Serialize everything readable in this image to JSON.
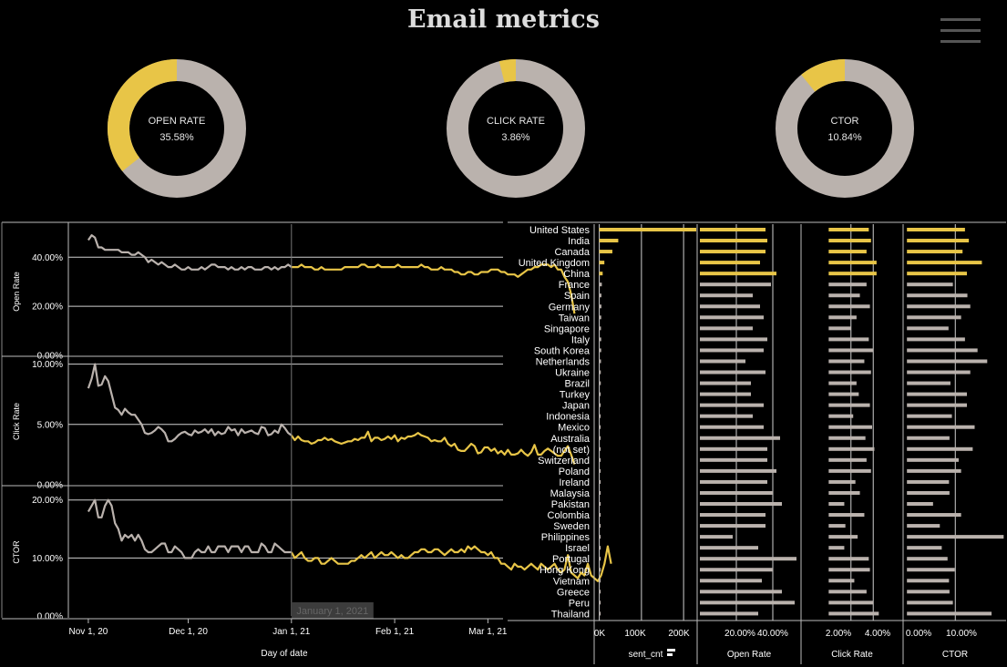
{
  "header": {
    "title": "Email metrics"
  },
  "colors": {
    "highlight": "#e8c547",
    "base": "#bab2ad",
    "grid": "#cfcfcf",
    "axis": "#ffffff"
  },
  "donuts": [
    {
      "label": "OPEN RATE",
      "value_text": "35.58%",
      "value": 35.58
    },
    {
      "label": "CLICK RATE",
      "value_text": "3.86%",
      "value": 3.86
    },
    {
      "label": "CTOR",
      "value_text": "10.84%",
      "value": 10.84
    }
  ],
  "chart_data": [
    {
      "type": "line",
      "title": "",
      "xlabel": "Day of date",
      "x_ticks": [
        "Nov 1, 20",
        "Dec 1, 20",
        "Jan 1, 21",
        "Feb 1, 21",
        "Mar 1, 21"
      ],
      "x_range": [
        "2020-10-26",
        "2021-03-05"
      ],
      "reference_line": {
        "date": "2021-01-01",
        "label": "January 1, 2021"
      },
      "series": [
        {
          "ylabel": "Open Rate",
          "y_ticks": [
            "0.00%",
            "20.00%",
            "40.00%"
          ],
          "ylim": [
            0,
            52
          ],
          "start_date": "2020-11-01",
          "values": [
            47,
            49,
            48,
            44,
            44,
            43,
            43,
            43,
            43,
            43,
            42,
            42,
            42,
            41,
            41,
            42,
            41,
            40,
            38,
            39,
            38,
            37,
            38,
            37,
            36,
            36,
            37,
            36,
            35,
            35,
            36,
            35,
            35,
            35,
            36,
            35,
            36,
            37,
            37,
            36,
            36,
            36,
            35,
            36,
            35,
            35,
            36,
            35,
            36,
            36,
            35,
            35,
            35,
            36,
            36,
            35,
            36,
            35,
            36,
            36,
            37,
            36,
            36,
            36,
            37,
            36,
            36,
            36,
            35,
            35,
            36,
            35,
            35,
            35,
            35,
            35,
            35,
            36,
            36,
            36,
            36,
            36,
            37,
            37,
            36,
            36,
            36,
            37,
            36,
            36,
            36,
            36,
            36,
            37,
            36,
            36,
            36,
            36,
            36,
            36,
            37,
            36,
            36,
            35,
            35,
            35,
            36,
            35,
            35,
            35,
            34,
            34,
            33,
            33,
            34,
            34,
            33,
            33,
            34,
            34,
            34,
            35,
            35,
            35,
            34,
            34,
            33,
            33,
            33,
            32,
            33,
            34,
            35,
            35,
            36,
            36,
            37,
            37,
            37,
            36,
            37,
            35,
            35,
            32,
            30,
            25,
            17
          ]
        },
        {
          "ylabel": "Click Rate",
          "y_ticks": [
            "0.00%",
            "5.00%",
            "10.00%"
          ],
          "ylim": [
            0,
            10.5
          ],
          "start_date": "2020-11-01",
          "values": [
            8.0,
            8.8,
            10.0,
            8.2,
            8.3,
            9.0,
            8.6,
            7.5,
            6.4,
            6.2,
            5.8,
            6.3,
            6.0,
            5.8,
            5.8,
            5.4,
            5.0,
            4.3,
            4.2,
            4.3,
            4.5,
            4.8,
            4.6,
            4.3,
            3.6,
            3.6,
            3.8,
            4.1,
            4.3,
            4.4,
            4.2,
            4.1,
            4.5,
            4.3,
            4.4,
            4.6,
            4.3,
            4.6,
            4.1,
            4.4,
            4.2,
            4.3,
            4.8,
            4.5,
            4.6,
            4.1,
            4.6,
            4.3,
            4.4,
            4.5,
            4.3,
            4.2,
            4.8,
            4.7,
            4.1,
            4.2,
            4.5,
            4.3,
            5.0,
            4.7,
            4.3,
            4.1,
            3.7,
            4.0,
            3.7,
            3.6,
            3.6,
            3.4,
            3.5,
            3.7,
            3.7,
            3.9,
            3.7,
            3.8,
            3.6,
            3.5,
            3.4,
            3.5,
            3.6,
            3.6,
            3.8,
            3.7,
            3.9,
            3.9,
            4.4,
            3.6,
            3.9,
            3.9,
            3.7,
            3.8,
            4.0,
            3.8,
            4.1,
            3.6,
            3.9,
            3.8,
            4.0,
            4.0,
            4.1,
            4.3,
            4.1,
            4.0,
            3.9,
            3.6,
            3.7,
            3.6,
            3.6,
            3.9,
            3.4,
            3.2,
            3.4,
            2.9,
            2.8,
            2.8,
            3.1,
            3.4,
            3.2,
            2.6,
            2.7,
            3.1,
            3.1,
            2.8,
            3.0,
            2.6,
            2.8,
            2.5,
            2.9,
            2.5,
            2.5,
            2.6,
            2.9,
            2.6,
            2.4,
            2.7,
            3.3,
            2.5,
            2.5,
            2.8,
            3.0,
            2.8,
            2.6,
            2.4,
            2.4,
            2.8,
            3.2,
            2.5,
            1.7
          ]
        },
        {
          "ylabel": "CTOR",
          "y_ticks": [
            "0.00%",
            "10.00%",
            "20.00%"
          ],
          "ylim": [
            0,
            22
          ],
          "start_date": "2020-11-01",
          "values": [
            18,
            19,
            20,
            17,
            17,
            19,
            20,
            19,
            16,
            15,
            13,
            14,
            13.5,
            14,
            13,
            14,
            13,
            11.5,
            11,
            11,
            11.5,
            12,
            12.5,
            12.5,
            11,
            11,
            12,
            11.5,
            11,
            10,
            10,
            10,
            11,
            11.5,
            11,
            11,
            12,
            11,
            11,
            12,
            12,
            12,
            11,
            12,
            12,
            12,
            11,
            12,
            12,
            11,
            11,
            11,
            12.5,
            12,
            11,
            11,
            12.5,
            12,
            11.5,
            11,
            11,
            11,
            10,
            10.5,
            11,
            10,
            9.5,
            9.5,
            10,
            10,
            9,
            9,
            9.5,
            10,
            9.5,
            9,
            9,
            9,
            9,
            9.5,
            9.5,
            10,
            10.5,
            10,
            10.5,
            11,
            10,
            10.5,
            11,
            10.5,
            10.5,
            11,
            10.5,
            10,
            10.5,
            10,
            10,
            10.5,
            11,
            11,
            11.5,
            11.5,
            11,
            11,
            11.5,
            11.5,
            11,
            10.5,
            11,
            11.5,
            11,
            11,
            11.5,
            11,
            12,
            11.5,
            12,
            11.5,
            11,
            11,
            10.5,
            11,
            10,
            10,
            9,
            9,
            8.5,
            8,
            9,
            8.5,
            8.5,
            8,
            8.5,
            9,
            8.5,
            8,
            9,
            8.5,
            8,
            8.5,
            9,
            8,
            7.5,
            8,
            10.5,
            7.5,
            7,
            6.5,
            7.5,
            7,
            9,
            7,
            6.5,
            6,
            7,
            9,
            12,
            9
          ]
        }
      ]
    },
    {
      "type": "bar",
      "orientation": "horizontal",
      "categories": [
        "United States",
        "India",
        "Canada",
        "United Kingdom",
        "China",
        "France",
        "Spain",
        "Germany",
        "Taiwan",
        "Singapore",
        "Italy",
        "South Korea",
        "Netherlands",
        "Ukraine",
        "Brazil",
        "Turkey",
        "Japan",
        "Indonesia",
        "Mexico",
        "Australia",
        "(not set)",
        "Switzerland",
        "Poland",
        "Ireland",
        "Malaysia",
        "Pakistan",
        "Colombia",
        "Sweden",
        "Philippines",
        "Israel",
        "Portugal",
        "Hong Kong",
        "Vietnam",
        "Greece",
        "Peru",
        "Thailand"
      ],
      "highlighted": [
        "United States",
        "India",
        "Canada",
        "United Kingdom",
        "China"
      ],
      "series": [
        {
          "name": "sent_cnt",
          "x_ticks": [
            "0K",
            "100K",
            "200K"
          ],
          "xlim": [
            -10000,
            230000
          ],
          "values": [
            232000,
            45000,
            31000,
            12000,
            8000,
            6000,
            5000,
            5000,
            4500,
            4000,
            4500,
            4500,
            4000,
            3500,
            3500,
            3000,
            3000,
            3000,
            3000,
            3000,
            3000,
            2500,
            2500,
            2500,
            2500,
            2500,
            2500,
            2500,
            2000,
            2000,
            2000,
            2000,
            2000,
            2000,
            2000,
            2000
          ]
        },
        {
          "name": "Open Rate",
          "x_ticks": [
            "20.00%",
            "40.00%"
          ],
          "xlim": [
            -1,
            55
          ],
          "values": [
            36,
            37,
            36,
            33,
            42,
            39,
            29,
            33,
            35,
            29,
            37,
            35,
            25,
            36,
            28,
            28,
            35,
            29,
            35,
            44,
            37,
            37,
            42,
            37,
            40,
            45,
            36,
            36,
            18,
            32,
            53,
            40,
            34,
            45,
            52,
            32
          ]
        },
        {
          "name": "Click Rate",
          "x_ticks": [
            "2.00%",
            "4.00%"
          ],
          "xlim": [
            -2.4,
            6.6
          ],
          "values": [
            3.6,
            3.8,
            3.4,
            4.3,
            4.3,
            3.4,
            2.8,
            3.7,
            2.5,
            2.0,
            3.6,
            4.0,
            3.2,
            3.8,
            2.5,
            2.7,
            3.7,
            2.2,
            3.9,
            3.3,
            4.1,
            3.4,
            3.8,
            2.4,
            2.8,
            1.4,
            3.2,
            1.5,
            2.6,
            1.4,
            3.6,
            3.7,
            2.3,
            3.4,
            4.0,
            4.5
          ]
        },
        {
          "name": "CTOR",
          "x_ticks": [
            "0.00%",
            "10.00%"
          ],
          "xlim": [
            -0.6,
            20.5
          ],
          "values": [
            12,
            12.8,
            11.5,
            15.5,
            12.4,
            9.5,
            12.5,
            13.1,
            11.2,
            8.6,
            12,
            14.6,
            16.6,
            13.1,
            9,
            12.4,
            12.4,
            9.3,
            14,
            8.8,
            13.6,
            10.7,
            11.2,
            8.7,
            8.8,
            5.4,
            11.2,
            6.8,
            20,
            7.2,
            8.4,
            9.9,
            8.7,
            8.8,
            9.5,
            17.5
          ]
        }
      ]
    }
  ]
}
